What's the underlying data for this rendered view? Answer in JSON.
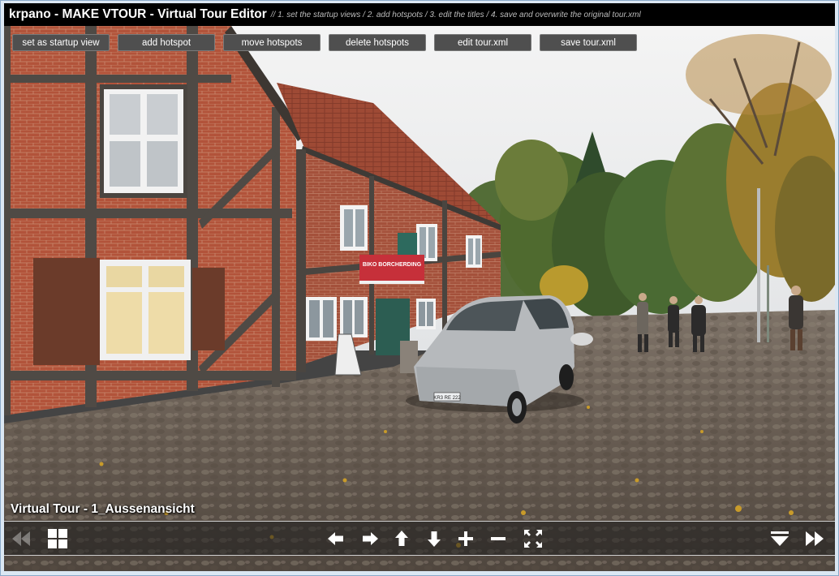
{
  "titlebar": {
    "title": "krpano - MAKE VTOUR - Virtual Tour Editor",
    "subtitle": "// 1. set the startup views / 2. add hotspots / 3. edit the titles / 4. save and overwrite the original tour.xml"
  },
  "toolbar": {
    "buttons": [
      "set as startup view",
      "add hotspot",
      "move hotspots",
      "delete hotspots",
      "edit tour.xml",
      "save tour.xml"
    ]
  },
  "scene": {
    "title": "Virtual Tour - 1_Aussenansicht",
    "banner_text": "BIKO BORCHERDING"
  },
  "plate_text": "KR3 RE 222",
  "nav": {
    "icons": [
      "skip-back-icon",
      "thumbnails-grid-icon",
      "arrow-left-icon",
      "arrow-right-icon",
      "arrow-up-icon",
      "arrow-down-icon",
      "zoom-in-icon",
      "zoom-out-icon",
      "fullscreen-icon",
      "hide-bar-icon",
      "skip-forward-icon"
    ]
  },
  "colors": {
    "titlebar_bg": "#000000",
    "button_bg": "#4f4f4f",
    "icon_color": "#ffffff"
  }
}
